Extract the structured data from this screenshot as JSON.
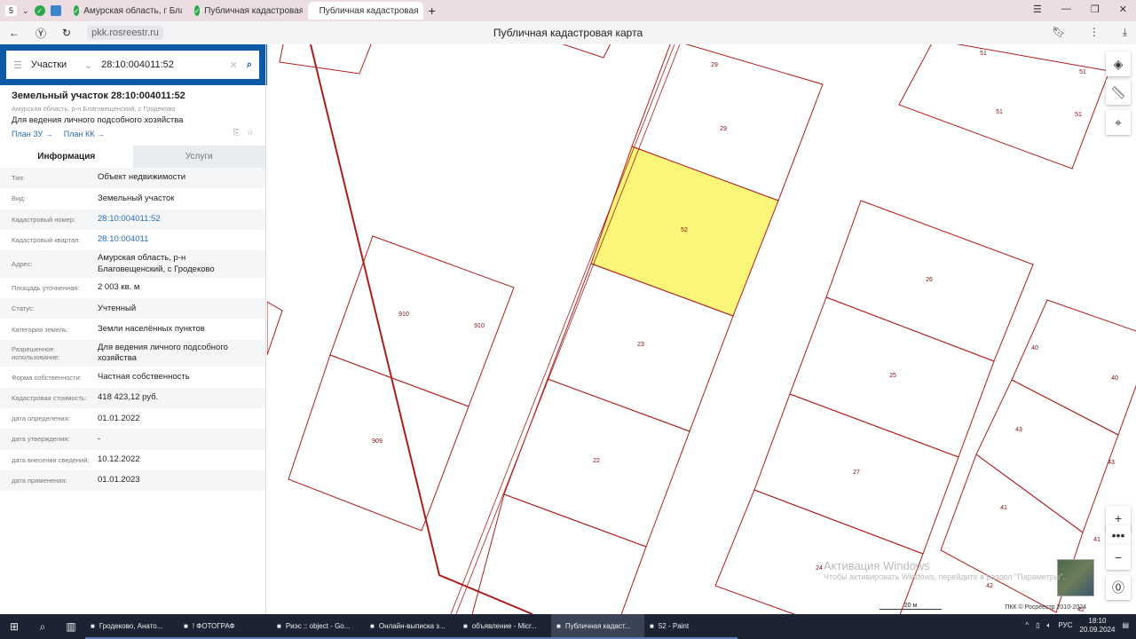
{
  "browser": {
    "tab_count": "5",
    "tabs": [
      {
        "label": "Амурская область, г Благ"
      },
      {
        "label": "Публичная кадастровая"
      },
      {
        "label": "Публичная кадастровая"
      }
    ],
    "url": "pkk.rosreestr.ru",
    "page_title": "Публичная кадастровая карта"
  },
  "search": {
    "category": "Участки",
    "query": "28:10:004011:52"
  },
  "parcel": {
    "title": "Земельный участок 28:10:004011:52",
    "address_short": "Амурская область, р-н Благовещенский, с Гродеково",
    "use": "Для ведения личного подсобного хозяйства",
    "link_plan_zu": "План ЗУ →",
    "link_plan_kk": "План КК →"
  },
  "panel_tabs": {
    "info": "Информация",
    "services": "Услуги"
  },
  "rows": [
    {
      "key": "Тип:",
      "value": "Объект недвижимости"
    },
    {
      "key": "Вид:",
      "value": "Земельный участок"
    },
    {
      "key": "Кадастровый номер:",
      "value": "28:10:004011:52",
      "link": true
    },
    {
      "key": "Кадастровый квартал:",
      "value": "28:10:004011",
      "link": true
    },
    {
      "key": "Адрес:",
      "value": "Амурская область, р-н Благовещенский, с Гродеково"
    },
    {
      "key": "Площадь уточненная:",
      "value": "2 003 кв. м"
    },
    {
      "key": "Статус:",
      "value": "Учтенный"
    },
    {
      "key": "Категория земель:",
      "value": "Земли населённых пунктов"
    },
    {
      "key": "Разрешенное использование:",
      "value": "Для ведения личного подсобного хозяйства"
    },
    {
      "key": "Форма собственности:",
      "value": "Частная собственность"
    },
    {
      "key": "Кадастровая стоимость:",
      "value": "418 423,12 руб."
    },
    {
      "key": "дата определения:",
      "value": "01.01.2022"
    },
    {
      "key": "дата утверждения:",
      "value": "-"
    },
    {
      "key": "дата внесения сведений:",
      "value": "10.12.2022"
    },
    {
      "key": "дата применения:",
      "value": "01.01.2023"
    }
  ],
  "map": {
    "parcel_labels": [
      "29",
      "29",
      "52",
      "23",
      "22",
      "910",
      "910",
      "909",
      "26",
      "25",
      "27",
      "51",
      "51",
      "51",
      "51",
      "40",
      "40",
      "43",
      "43",
      "41",
      "41",
      "24",
      "42",
      "42"
    ],
    "scale": "20 м",
    "attribution": "ПКК © Росреестр 2010-2024",
    "highlight_color": "#fbf57a",
    "boundary_color": "#b01c1c"
  },
  "watermark": {
    "line1": "Активация Windows",
    "line2": "Чтобы активировать Windows, перейдите в раздел \"Параметры\"."
  },
  "taskbar": {
    "items": [
      {
        "label": "Гродеково, Анато..."
      },
      {
        "label": "! ФОТОГРАФ"
      },
      {
        "label": "Риэс :: object - Go..."
      },
      {
        "label": "Онлайн-выписка з..."
      },
      {
        "label": "объявление - Micr..."
      },
      {
        "label": "Публичная кадаст..."
      },
      {
        "label": "52 - Paint"
      }
    ],
    "lang": "РУС",
    "time": "18:10",
    "date": "20.09.2024"
  }
}
